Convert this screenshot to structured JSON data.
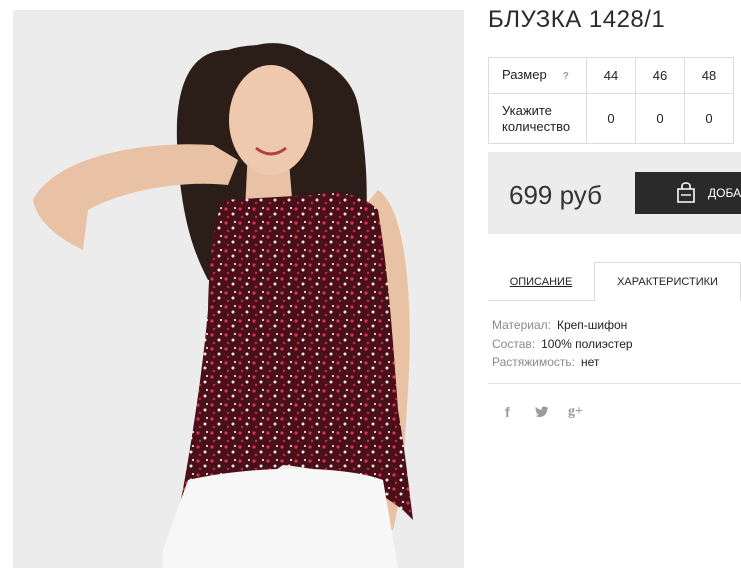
{
  "product": {
    "title": "БЛУЗКА 1428/1",
    "price": "699 руб"
  },
  "sizes": {
    "row_label": "Размер",
    "help": "?",
    "values": [
      "44",
      "46",
      "48"
    ],
    "qty_label": "Укажите количество",
    "quantities": [
      "0",
      "0",
      "0"
    ]
  },
  "cart": {
    "label": "ДОБАВИТЬ В КОРЗИНУ"
  },
  "tabs": {
    "description": "ОПИСАНИЕ",
    "characteristics": "ХАРАКТЕРИСТИКИ"
  },
  "specs": [
    {
      "key": "Материал:",
      "value": "Креп-шифон"
    },
    {
      "key": "Состав:",
      "value": "100% полиэстер"
    },
    {
      "key": "Растяжимость:",
      "value": "нет"
    }
  ],
  "social": {
    "facebook": "f",
    "twitter": "t",
    "googleplus": "g+"
  },
  "colors": {
    "button_bg": "#2a2a2a",
    "box_bg": "#ececec",
    "blouse": "#5a1620"
  }
}
